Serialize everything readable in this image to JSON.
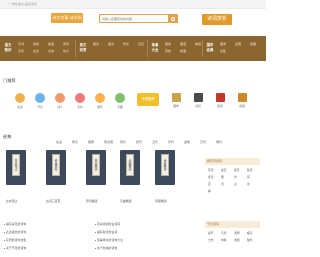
{
  "topbar": {
    "text": "一 学在语文,品鉴诗文"
  },
  "header": {
    "logo_text": "诗文名著·诗文网",
    "search_placeholder": "请输入您要查找的内容",
    "brand_text": "诗词赏析"
  },
  "nav": {
    "groups": [
      {
        "label": "语文\n知识",
        "links": [
          "字词",
          "拼音",
          "成语",
          "诗词",
          "汉字",
          "古文",
          "文言",
          "句子"
        ]
      },
      {
        "label": "美文\n欣赏",
        "links": [
          "散文",
          "美文",
          "作文",
          "日记"
        ]
      },
      {
        "label": "故事\n大全",
        "links": [
          "寓言",
          "童话",
          "神话",
          "历史",
          "成语"
        ]
      },
      {
        "label": "国学\n经典",
        "links": [
          "国学",
          "名著",
          "经典",
          "全集"
        ]
      }
    ]
  },
  "recommend": {
    "title": "门推荐",
    "items": [
      "古诗",
      "节日",
      "诗人",
      "名句",
      "朝代",
      "字典"
    ],
    "banner": "专题推荐",
    "right_items": [
      "国学",
      "诗词",
      "组词",
      "成语"
    ]
  },
  "books": {
    "title": "经典",
    "tabs": [
      "先秦",
      "两汉",
      "魏晋",
      "南北朝",
      "隋代",
      "唐代",
      "五代",
      "宋代",
      "金朝",
      "元代",
      "明代"
    ],
    "items": [
      {
        "cover": "古文观止",
        "caption": "古文观止"
      },
      {
        "cover": "资治通鉴",
        "caption": "古诗三百首"
      },
      {
        "cover": "宋词精选",
        "caption": "宋词精选"
      },
      {
        "cover": "元曲精选",
        "caption": "元曲精选"
      },
      {
        "cover": "诗经精选",
        "caption": "诗经精选"
      }
    ]
  },
  "sidebar": {
    "head1": "按写景诗词",
    "cells1": [
      "写景",
      "春天",
      "夏天",
      "秋天",
      "冬天",
      "雨",
      "雪",
      "风",
      "花",
      "月",
      "山",
      "水",
      "柳"
    ],
    "head2": "节日诗词",
    "cells2": [
      "春节",
      "元宵",
      "清明",
      "端午",
      "七夕",
      "中秋",
      "重阳",
      "除夕"
    ]
  },
  "bottom": {
    "left": [
      "描写春天的诗句",
      "表达思念的诗句",
      "写景的诗句合集",
      "关于节日的诗句"
    ],
    "right": [
      "有关离别的古诗词",
      "描写秋天的古诗",
      "赞美母亲的诗句大全",
      "关于友情的诗句"
    ]
  }
}
